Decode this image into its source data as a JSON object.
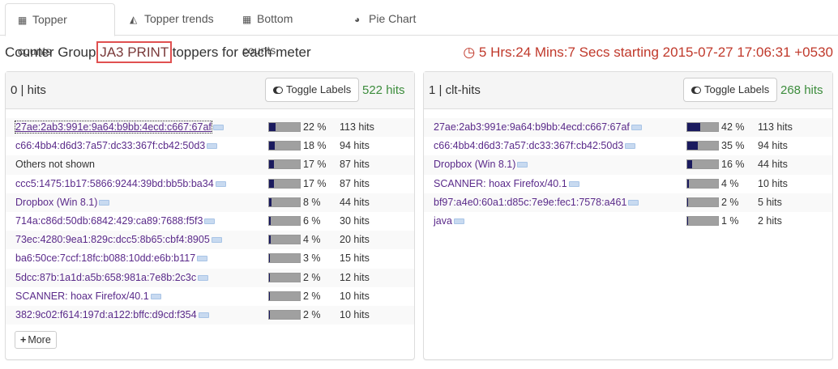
{
  "tabs": [
    {
      "label": "Topper counts",
      "icon": "table-icon",
      "glyph": "▦"
    },
    {
      "label": "Topper trends",
      "icon": "area-chart-icon",
      "glyph": "◭"
    },
    {
      "label": "Bottom counts",
      "icon": "table-icon",
      "glyph": "▦"
    },
    {
      "label": "Pie Chart",
      "icon": "pie-chart-icon",
      "glyph": "◕"
    }
  ],
  "header": {
    "prefix": "Counter Group ",
    "group": "JA3 PRINT",
    "suffix": " toppers for each meter",
    "timer": "5 Hrs:24 Mins:7 Secs starting 2015-07-27 17:06:31 +0530",
    "timer_icon": "clock-icon"
  },
  "colors": {
    "accent_green": "#3c8c3c",
    "timer_red": "#c0392b",
    "bar_fill": "#1a1a5e",
    "bar_bg": "#a0a0a0",
    "link": "#5a2a8a"
  },
  "panels": [
    {
      "title": "0 | hits",
      "toggle_label": "Toggle Labels",
      "total": "522 hits",
      "more_label": "More",
      "rows": [
        {
          "label": "27ae:2ab3:991e:9a64:b9bb:4ecd:c667:67af",
          "pct": "22 %",
          "fraction": 0.22,
          "hits": "113 hits",
          "tag": true,
          "link": true
        },
        {
          "label": "c66:4bb4:d6d3:7a57:dc33:367f:cb42:50d3",
          "pct": "18 %",
          "fraction": 0.18,
          "hits": "94 hits",
          "tag": true,
          "link": true
        },
        {
          "label": "Others not shown",
          "pct": "17 %",
          "fraction": 0.17,
          "hits": "87 hits",
          "tag": false,
          "link": false
        },
        {
          "label": "ccc5:1475:1b17:5866:9244:39bd:bb5b:ba34",
          "pct": "17 %",
          "fraction": 0.17,
          "hits": "87 hits",
          "tag": true,
          "link": true
        },
        {
          "label": "Dropbox (Win 8.1)",
          "pct": "8 %",
          "fraction": 0.08,
          "hits": "44 hits",
          "tag": true,
          "link": true
        },
        {
          "label": "714a:c86d:50db:6842:429:ca89:7688:f5f3",
          "pct": "6 %",
          "fraction": 0.06,
          "hits": "30 hits",
          "tag": true,
          "link": true
        },
        {
          "label": "73ec:4280:9ea1:829c:dcc5:8b65:cbf4:8905",
          "pct": "4 %",
          "fraction": 0.04,
          "hits": "20 hits",
          "tag": true,
          "link": true
        },
        {
          "label": "ba6:50ce:7ccf:18fc:b088:10dd:e6b:b117",
          "pct": "3 %",
          "fraction": 0.03,
          "hits": "15 hits",
          "tag": true,
          "link": true
        },
        {
          "label": "5dcc:87b:1a1d:a5b:658:981a:7e8b:2c3c",
          "pct": "2 %",
          "fraction": 0.02,
          "hits": "12 hits",
          "tag": true,
          "link": true
        },
        {
          "label": "SCANNER: hoax Firefox/40.1",
          "pct": "2 %",
          "fraction": 0.02,
          "hits": "10 hits",
          "tag": true,
          "link": true
        },
        {
          "label": "382:9c02:f614:197d:a122:bffc:d9cd:f354",
          "pct": "2 %",
          "fraction": 0.02,
          "hits": "10 hits",
          "tag": true,
          "link": true
        }
      ]
    },
    {
      "title": "1 | clt-hits",
      "toggle_label": "Toggle Labels",
      "total": "268 hits",
      "rows": [
        {
          "label": "27ae:2ab3:991e:9a64:b9bb:4ecd:c667:67af",
          "pct": "42 %",
          "fraction": 0.42,
          "hits": "113 hits",
          "tag": true,
          "link": true
        },
        {
          "label": "c66:4bb4:d6d3:7a57:dc33:367f:cb42:50d3",
          "pct": "35 %",
          "fraction": 0.35,
          "hits": "94 hits",
          "tag": true,
          "link": true
        },
        {
          "label": "Dropbox (Win 8.1)",
          "pct": "16 %",
          "fraction": 0.16,
          "hits": "44 hits",
          "tag": true,
          "link": true
        },
        {
          "label": "SCANNER: hoax Firefox/40.1",
          "pct": "4 %",
          "fraction": 0.04,
          "hits": "10 hits",
          "tag": true,
          "link": true
        },
        {
          "label": "bf97:a4e0:60a1:d85c:7e9e:fec1:7578:a461",
          "pct": "2 %",
          "fraction": 0.02,
          "hits": "5 hits",
          "tag": true,
          "link": true
        },
        {
          "label": "java",
          "pct": "1 %",
          "fraction": 0.01,
          "hits": "2 hits",
          "tag": true,
          "link": true
        }
      ]
    }
  ]
}
